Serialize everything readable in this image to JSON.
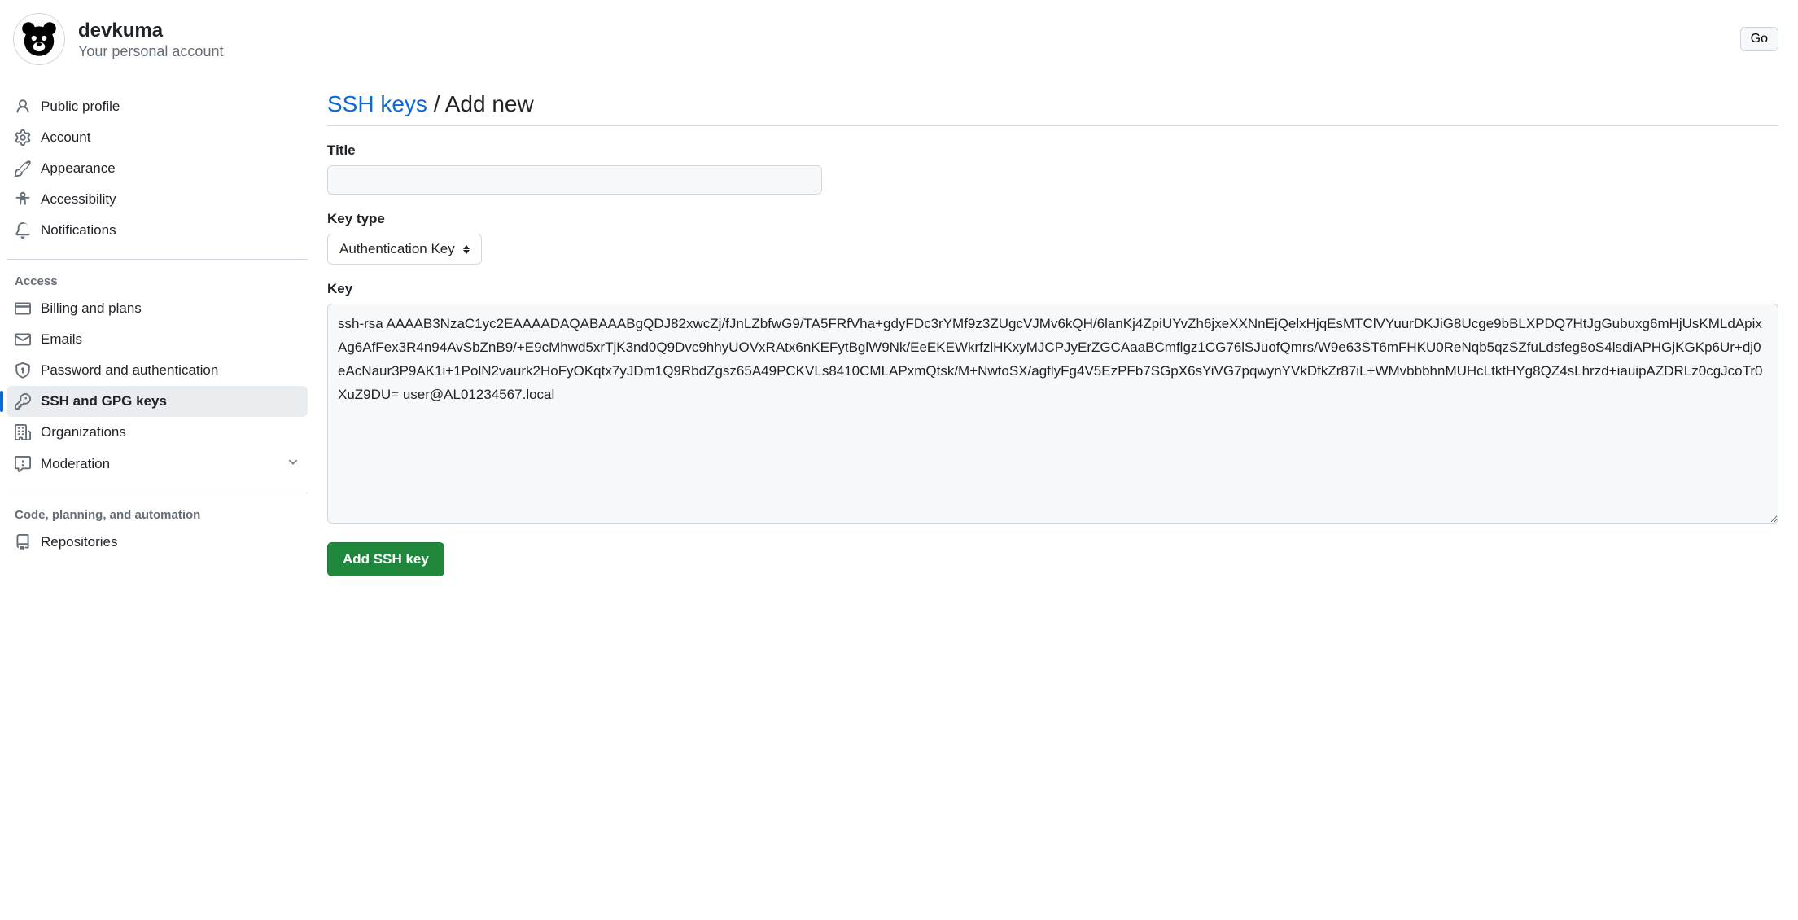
{
  "header": {
    "username": "devkuma",
    "subtitle": "Your personal account",
    "go_label": "Go"
  },
  "sidebar": {
    "items": [
      {
        "label": "Public profile",
        "icon": "person"
      },
      {
        "label": "Account",
        "icon": "gear"
      },
      {
        "label": "Appearance",
        "icon": "paintbrush"
      },
      {
        "label": "Accessibility",
        "icon": "accessibility"
      },
      {
        "label": "Notifications",
        "icon": "bell"
      }
    ],
    "section_access": "Access",
    "access_items": [
      {
        "label": "Billing and plans",
        "icon": "credit-card"
      },
      {
        "label": "Emails",
        "icon": "mail"
      },
      {
        "label": "Password and authentication",
        "icon": "shield-lock"
      },
      {
        "label": "SSH and GPG keys",
        "icon": "key",
        "active": true
      },
      {
        "label": "Organizations",
        "icon": "organization"
      },
      {
        "label": "Moderation",
        "icon": "report",
        "has_chevron": true
      }
    ],
    "section_code": "Code, planning, and automation",
    "code_items": [
      {
        "label": "Repositories",
        "icon": "repo"
      }
    ]
  },
  "main": {
    "breadcrumb_link": "SSH keys",
    "breadcrumb_sep": "/",
    "breadcrumb_current": "Add new",
    "title_label": "Title",
    "title_value": "",
    "keytype_label": "Key type",
    "keytype_value": "Authentication Key",
    "key_label": "Key",
    "key_value": "ssh-rsa AAAAB3NzaC1yc2EAAAADAQABAAABgQDJ82xwcZj/fJnLZbfwG9/TA5FRfVha+gdyFDc3rYMf9z3ZUgcVJMv6kQH/6lanKj4ZpiUYvZh6jxeXXNnEjQelxHjqEsMTClVYuurDKJiG8Ucge9bBLXPDQ7HtJgGubuxg6mHjUsKMLdApixAg6AfFex3R4n94AvSbZnB9/+E9cMhwd5xrTjK3nd0Q9Dvc9hhyUOVxRAtx6nKEFytBglW9Nk/EeEKEWkrfzlHKxyMJCPJyErZGCAaaBCmflgz1CG76lSJuofQmrs/W9e63ST6mFHKU0ReNqb5qzSZfuLdsfeg8oS4lsdiAPHGjKGKp6Ur+dj0eAcNaur3P9AK1i+1PolN2vaurk2HoFyOKqtx7yJDm1Q9RbdZgsz65A49PCKVLs8410CMLAPxmQtsk/M+NwtoSX/agflyFg4V5EzPFb7SGpX6sYiVG7pqwynYVkDfkZr87iL+WMvbbbhnMUHcLtktHYg8QZ4sLhrzd+iauipAZDRLz0cgJcoTr0XuZ9DU= user@AL01234567.local",
    "submit_label": "Add SSH key"
  }
}
